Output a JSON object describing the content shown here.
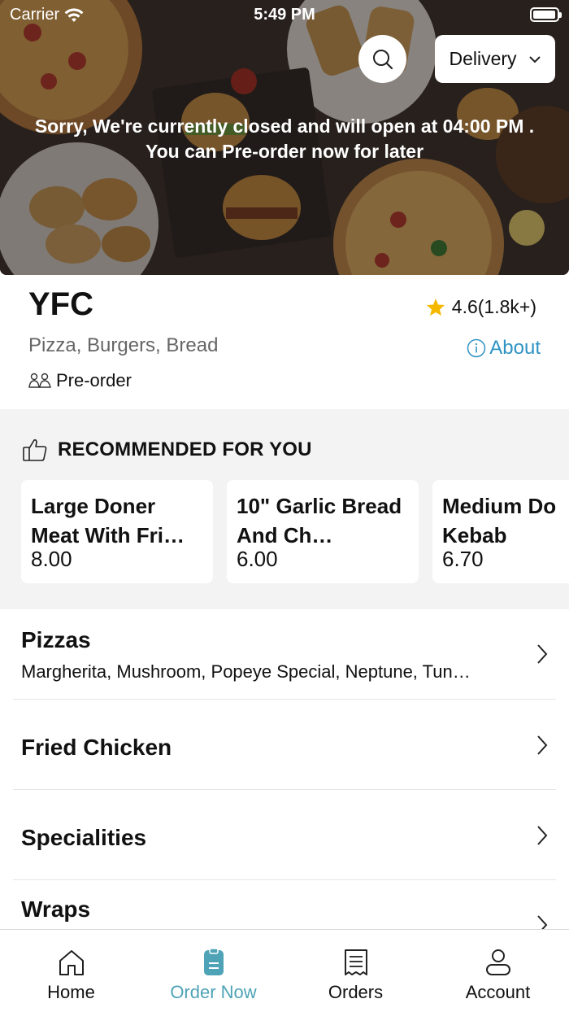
{
  "status_bar": {
    "carrier": "Carrier",
    "time": "5:49 PM",
    "battery_level": 0.95
  },
  "hero": {
    "search_icon": "search-icon",
    "delivery_label": "Delivery",
    "closed_message_line1": "Sorry, We're currently closed and will open at 04:00 PM .",
    "closed_message_line2": "You can Pre-order now for later"
  },
  "restaurant": {
    "name": "YFC",
    "rating": "4.6(1.8k+)",
    "cuisines": "Pizza, Burgers, Bread",
    "about_label": "About",
    "preorder_label": "Pre-order"
  },
  "recommended": {
    "title": "RECOMMENDED FOR YOU",
    "items": [
      {
        "name": "Large Doner Meat With Fri…",
        "price": "8.00"
      },
      {
        "name": "10\" Garlic Bread And Ch…",
        "price": "6.00"
      },
      {
        "name": "Medium Do Kebab",
        "price": "6.70"
      }
    ]
  },
  "categories": [
    {
      "name": "Pizzas",
      "desc": "Margherita, Mushroom, Popeye Special, Neptune, Tun…"
    },
    {
      "name": "Fried Chicken",
      "desc": ""
    },
    {
      "name": "Specialities",
      "desc": ""
    },
    {
      "name": "Wraps",
      "desc": ""
    }
  ],
  "tabbar": {
    "tabs": [
      {
        "label": "Home",
        "icon": "home-icon"
      },
      {
        "label": "Order Now",
        "icon": "order-icon"
      },
      {
        "label": "Orders",
        "icon": "receipt-icon"
      },
      {
        "label": "Account",
        "icon": "account-icon"
      }
    ],
    "active_index": 1
  },
  "colors": {
    "accent": "#4ea3b6",
    "about_link": "#2f93c4",
    "star": "#f5b800"
  }
}
